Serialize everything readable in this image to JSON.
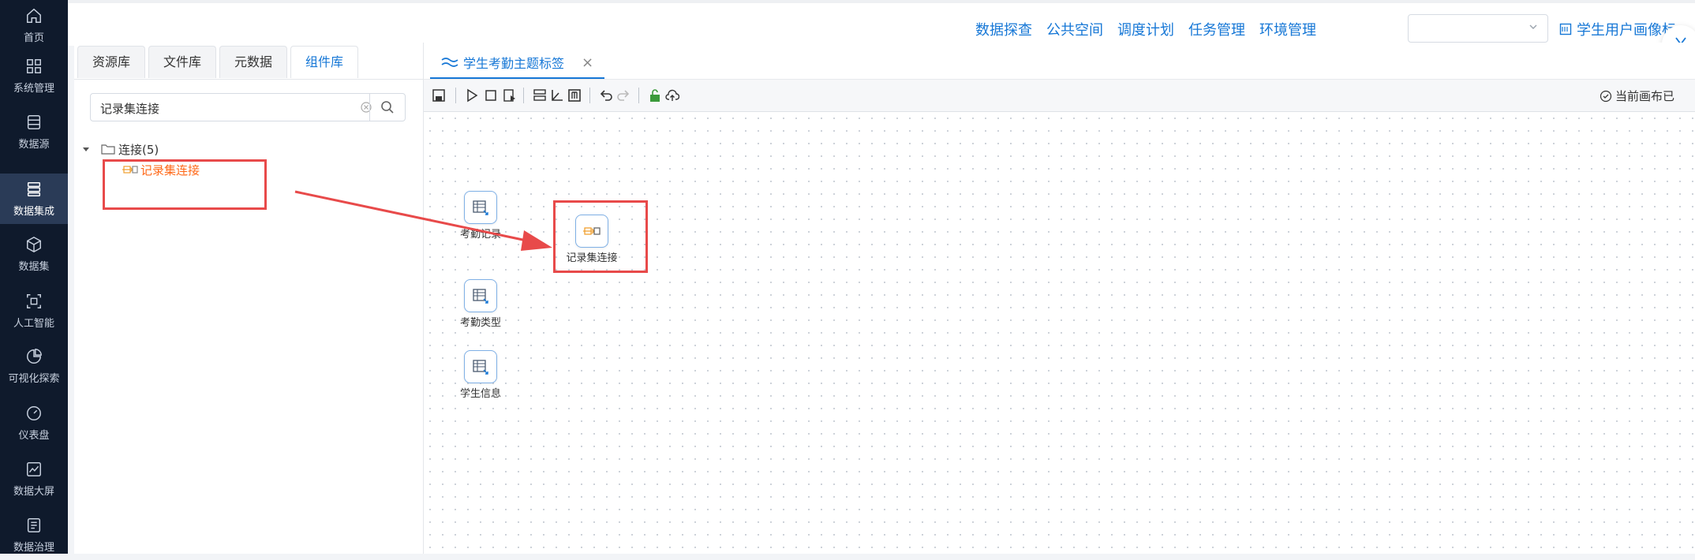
{
  "sidebar": {
    "items": [
      {
        "label": "首页",
        "icon": "home-icon"
      },
      {
        "label": "系统管理",
        "icon": "grid-icon"
      },
      {
        "label": "数据源",
        "icon": "database-icon"
      },
      {
        "label": "数据集成",
        "icon": "stack-icon"
      },
      {
        "label": "数据集",
        "icon": "cube-icon"
      },
      {
        "label": "人工智能",
        "icon": "ai-scan-icon"
      },
      {
        "label": "可视化探索",
        "icon": "pie-chart-icon"
      },
      {
        "label": "仪表盘",
        "icon": "gauge-icon"
      },
      {
        "label": "数据大屏",
        "icon": "line-chart-icon"
      },
      {
        "label": "数据治理",
        "icon": "list-icon"
      }
    ],
    "active_index": 3
  },
  "header": {
    "links": [
      "数据探查",
      "公共空间",
      "调度计划",
      "任务管理",
      "环境管理"
    ],
    "select_value": "",
    "profile_label": "学生用户画像标"
  },
  "left_panel": {
    "tabs": [
      "资源库",
      "文件库",
      "元数据",
      "组件库"
    ],
    "active_tab": 3,
    "search_value": "记录集连接",
    "tree": {
      "folder": "连接(5)",
      "child": "记录集连接"
    }
  },
  "editor": {
    "tab_title": "学生考勤主题标签",
    "canvas_status": "当前画布已",
    "nodes": [
      {
        "label": "考勤记录"
      },
      {
        "label": "记录集连接"
      },
      {
        "label": "考勤类型"
      },
      {
        "label": "学生信息"
      }
    ]
  },
  "colors": {
    "accent": "#1677d6",
    "highlight": "#ff6a1a",
    "annotation": "#e84a4a",
    "sidebar_bg": "#0f1a2c"
  }
}
